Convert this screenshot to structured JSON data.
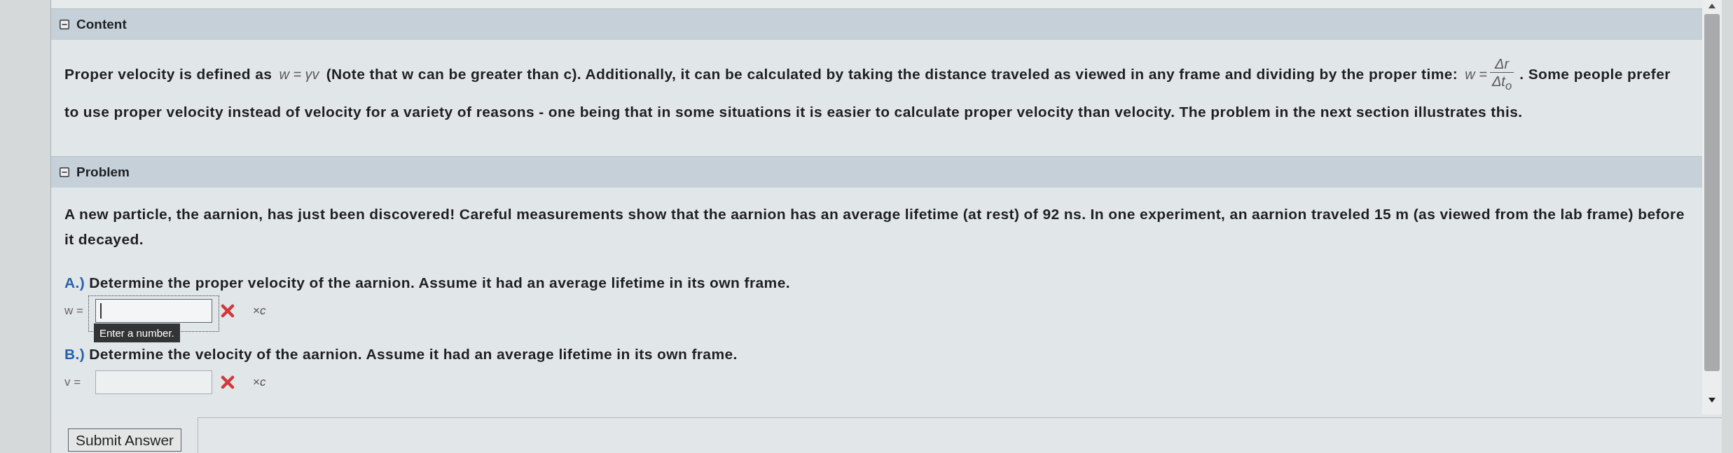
{
  "sections": [
    {
      "kind": "intro",
      "title": "Content",
      "expanded": true,
      "paragraph": [
        {
          "kind": "text",
          "text": "Proper velocity is defined as"
        },
        {
          "kind": "math",
          "text": "w = γv"
        },
        {
          "kind": "text",
          "text": "(Note that w can be greater than c). Additionally, it can be calculated by taking the distance traveled as viewed in any frame and dividing by the proper time:"
        },
        {
          "kind": "fraction",
          "lead": "w =",
          "numerator": "Δr",
          "denominator": "Δt$_{o}$"
        },
        {
          "kind": "text",
          "text": ". Some people prefer to use proper velocity instead of velocity for a variety of reasons - one being that in some situations it is easier to calculate proper velocity than velocity. The problem in the next section illustrates this."
        }
      ]
    },
    {
      "kind": "problem",
      "title": "Problem",
      "expanded": true,
      "statement": "A new particle, the aarnion, has just been discovered! Careful measurements show that the aarnion has an average lifetime (at rest) of 92 ns. In one experiment, an aarnion traveled 15 m (as viewed from the lab frame) before it decayed.",
      "parts": [
        {
          "label": "A.)",
          "question": "Determine the proper velocity of the aarnion. Assume it had an average lifetime in its own frame.",
          "variable": "w =",
          "focused": true,
          "tooltip": "Enter a number.",
          "correct": false,
          "unit": "×*c*"
        },
        {
          "label": "B.)",
          "question": "Determine the velocity of the aarnion. Assume it had an average lifetime in its own frame.",
          "variable": "v =",
          "focused": false,
          "correct": false,
          "unit": "×*c*"
        }
      ]
    }
  ],
  "submit_button": "Submit Answer"
}
